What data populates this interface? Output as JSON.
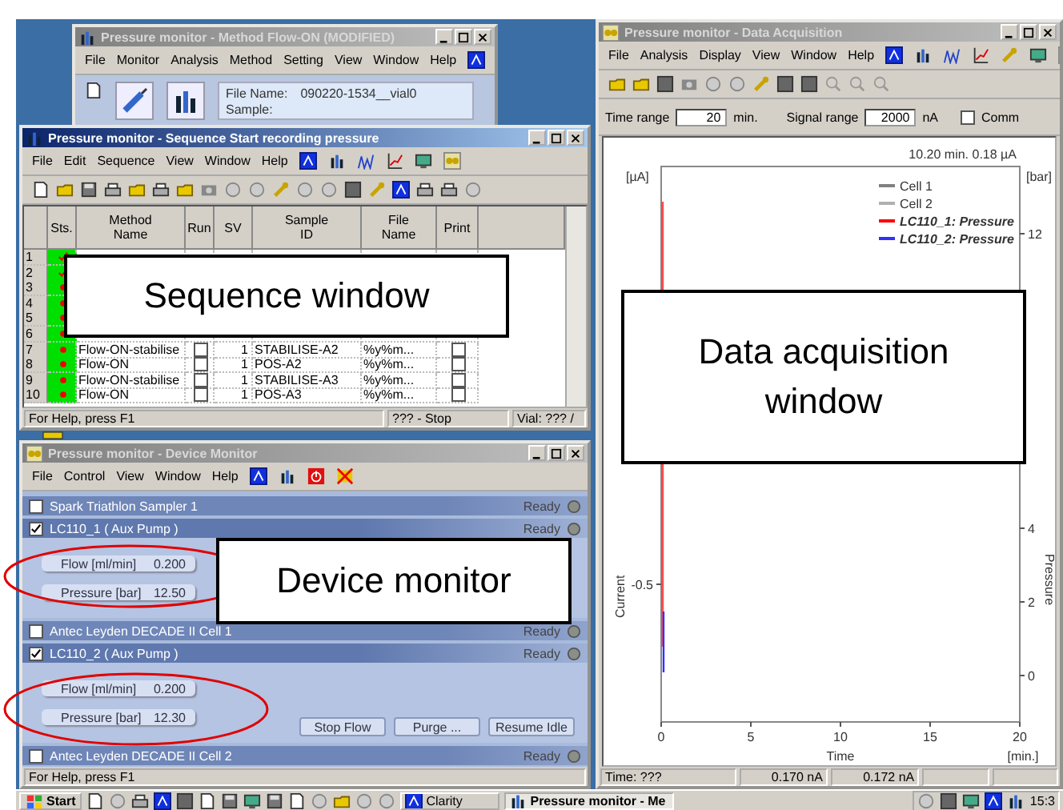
{
  "method_window": {
    "title": "Pressure monitor - Method  Flow-ON (MODIFIED)",
    "active": false,
    "menu": [
      "File",
      "Monitor",
      "Analysis",
      "Method",
      "Setting",
      "View",
      "Window",
      "Help"
    ],
    "file_name_label": "File Name:",
    "file_name": "090220-1534__vial0",
    "sample_label": "Sample:"
  },
  "sequence_window": {
    "title": "Pressure monitor - Sequence Start recording pressure",
    "active": true,
    "menu": [
      "File",
      "Edit",
      "Sequence",
      "View",
      "Window",
      "Help"
    ],
    "columns": [
      "Sts.",
      "Method Name",
      "Run",
      "SV",
      "Sample ID",
      "File Name",
      "Print"
    ],
    "rows": [
      {
        "num": "1",
        "done": true
      },
      {
        "num": "2",
        "done": true
      },
      {
        "num": "3",
        "done": false
      },
      {
        "num": "4",
        "done": false
      },
      {
        "num": "5",
        "done": false
      },
      {
        "num": "6",
        "done": false
      },
      {
        "num": "7",
        "done": false,
        "method": "Flow-ON-stabilise",
        "run": false,
        "sv": "1",
        "sample_id": "STABILISE-A2",
        "file_name": "%y%m...",
        "print": false
      },
      {
        "num": "8",
        "done": false,
        "method": "Flow-ON",
        "run": false,
        "sv": "1",
        "sample_id": "POS-A2",
        "file_name": "%y%m...",
        "print": false
      },
      {
        "num": "9",
        "done": false,
        "method": "Flow-ON-stabilise",
        "run": false,
        "sv": "1",
        "sample_id": "STABILISE-A3",
        "file_name": "%y%m...",
        "print": false
      },
      {
        "num": "10",
        "done": false,
        "method": "Flow-ON",
        "run": false,
        "sv": "1",
        "sample_id": "POS-A3",
        "file_name": "%y%m...",
        "print": false
      }
    ],
    "status_bar": [
      "For Help, press F1",
      "??? - Stop",
      "Vial: ??? /"
    ]
  },
  "device_monitor": {
    "title": "Pressure monitor - Device Monitor",
    "active": false,
    "menu": [
      "File",
      "Control",
      "View",
      "Window",
      "Help"
    ],
    "devices": [
      {
        "name": "Spark Triathlon Sampler 1",
        "checked": false,
        "expanded": false,
        "status": "Ready"
      },
      {
        "name": "LC110_1 ( Aux Pump )",
        "checked": true,
        "expanded": true,
        "status": "Ready",
        "fields": [
          {
            "label": "Flow [ml/min]",
            "value": "0.200"
          },
          {
            "label": "Pressure [bar]",
            "value": "12.50"
          }
        ]
      },
      {
        "name": "Antec Leyden DECADE II Cell 1",
        "checked": false,
        "expanded": false,
        "status": "Ready"
      },
      {
        "name": "LC110_2 ( Aux Pump )",
        "checked": true,
        "expanded": true,
        "status": "Ready",
        "fields": [
          {
            "label": "Flow [ml/min]",
            "value": "0.200"
          },
          {
            "label": "Pressure [bar]",
            "value": "12.30"
          }
        ],
        "buttons": [
          "Stop Flow",
          "Purge ...",
          "Resume Idle"
        ]
      },
      {
        "name": "Antec Leyden DECADE II Cell 2",
        "checked": false,
        "expanded": false,
        "status": "Ready"
      }
    ],
    "status_bar": "For Help, press F1"
  },
  "data_window": {
    "title": "Pressure monitor - Data Acquisition",
    "active": false,
    "menu": [
      "File",
      "Analysis",
      "Display",
      "View",
      "Window",
      "Help"
    ],
    "time_range_label": "Time range",
    "time_range": "20",
    "time_unit": "min.",
    "signal_range_label": "Signal range",
    "signal_range": "2000",
    "signal_unit": "nA",
    "comm_label": "Comm",
    "comm_checked": false,
    "plot": {
      "readout": "10.20 min.  0.18 µA",
      "y_unit": "[µA]",
      "left_tick": "-0.5",
      "left_label": "Current",
      "y2_unit": "[bar]",
      "right_label": "Pressure",
      "right_ticks": [
        "12",
        "4",
        "2",
        "0"
      ],
      "x_ticks": [
        "0",
        "5",
        "10",
        "15",
        "20"
      ],
      "x_label": "Time",
      "x_unit": "[min.]",
      "legend": [
        {
          "name": "Cell 1",
          "color": "#808080",
          "emphasis": false
        },
        {
          "name": "Cell 2",
          "color": "#b0b0b0",
          "emphasis": false
        },
        {
          "name": "LC110_1: Pressure",
          "color": "#ff0000",
          "emphasis": true
        },
        {
          "name": "LC110_2: Pressure",
          "color": "#3030ff",
          "emphasis": true
        }
      ]
    },
    "status_bar": [
      "Time: ???",
      "0.170 nA",
      "0.172 nA"
    ]
  },
  "callouts": [
    {
      "text": "Sequence window"
    },
    {
      "text": "Data acquisition window"
    },
    {
      "text": "Device monitor"
    }
  ],
  "taskbar": {
    "start": "Start",
    "tasks": [
      {
        "label": "Clarity",
        "selected": false
      },
      {
        "label": "Pressure monitor - Me",
        "selected": true
      }
    ],
    "clock": "15:3"
  }
}
